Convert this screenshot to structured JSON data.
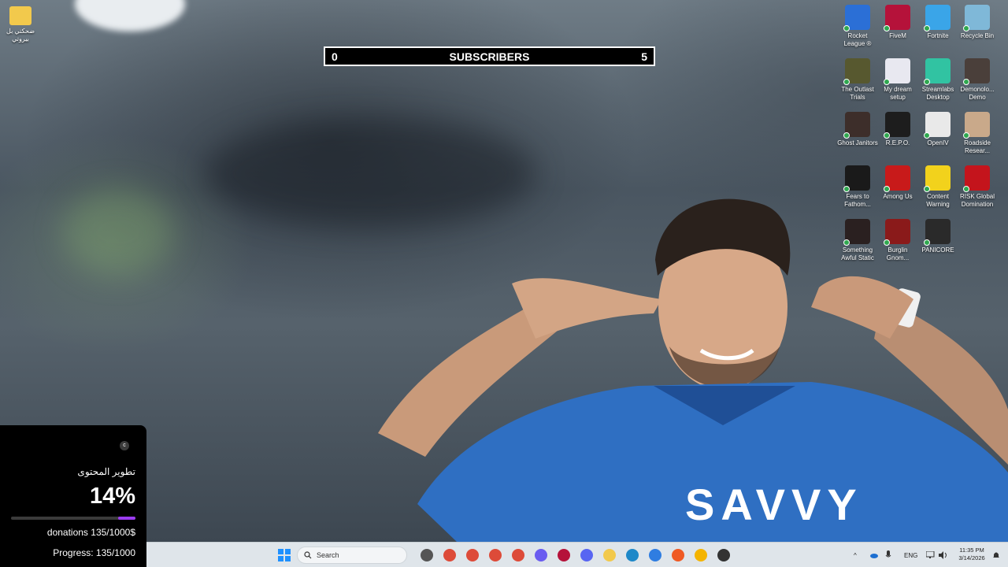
{
  "desktop": {
    "left_icons": [
      {
        "label": "ضحكتي بل بيروتي",
        "icon": "folder-icon",
        "color": "#f2c94c"
      }
    ],
    "icons": [
      {
        "label": "Rocket League ®",
        "icon": "rocket-league-icon",
        "color": "#2b6fd6"
      },
      {
        "label": "FiveM",
        "icon": "fivem-icon",
        "color": "#b5123a"
      },
      {
        "label": "Fortnite",
        "icon": "fortnite-icon",
        "color": "#3aa5e8"
      },
      {
        "label": "Recycle Bin",
        "icon": "recycle-bin-icon",
        "color": "#7fb8d8"
      },
      {
        "label": "The Outlast Trials",
        "icon": "outlast-icon",
        "color": "#57582f"
      },
      {
        "label": "My dream setup",
        "icon": "dream-setup-icon",
        "color": "#e8e8f0"
      },
      {
        "label": "Streamlabs Desktop",
        "icon": "streamlabs-icon",
        "color": "#31c3a2"
      },
      {
        "label": "Demonolo... Demo",
        "icon": "demonologist-icon",
        "color": "#4a3f3a"
      },
      {
        "label": "Ghost Janitors",
        "icon": "ghost-janitors-icon",
        "color": "#3d2e2a"
      },
      {
        "label": "R.E.P.O.",
        "icon": "repo-icon",
        "color": "#1d1d1d"
      },
      {
        "label": "OpenIV",
        "icon": "openiv-icon",
        "color": "#e9e9e9"
      },
      {
        "label": "Roadside Resear...",
        "icon": "roadside-research-icon",
        "color": "#c9a98a"
      },
      {
        "label": "Fears to Fathom...",
        "icon": "fears-to-fathom-icon",
        "color": "#1a1a1a"
      },
      {
        "label": "Among Us",
        "icon": "among-us-icon",
        "color": "#c81a1a"
      },
      {
        "label": "Content Warning",
        "icon": "content-warning-icon",
        "color": "#f2d21c"
      },
      {
        "label": "RISK Global Domination",
        "icon": "risk-icon",
        "color": "#c4141c"
      },
      {
        "label": "Something Awful Static",
        "icon": "something-awful-static-icon",
        "color": "#2a2020"
      },
      {
        "label": "Burglin Gnom...",
        "icon": "burglin-gnomes-icon",
        "color": "#8a1a1a"
      },
      {
        "label": "PANICORE",
        "icon": "panicore-icon",
        "color": "#2a2a2a"
      }
    ]
  },
  "subscriber_bar": {
    "start": "0",
    "title": "SUBSCRIBERS",
    "goal": "5"
  },
  "donation_widget": {
    "logo": "c",
    "title": "تطوير المحتوى",
    "percent_text": "14%",
    "percent": 14,
    "amount": "donations 135/1000$",
    "progress": "Progress: 135/1000",
    "bar_color": "#9b3cf0"
  },
  "taskbar": {
    "search_placeholder": "Search",
    "apps": [
      {
        "name": "start-button",
        "icon": "windows-icon",
        "color": "#1e90ff"
      },
      {
        "name": "file-explorer-small",
        "icon": "task-view-icon",
        "color": "#555"
      },
      {
        "name": "chrome-1",
        "icon": "chrome-icon",
        "color": "#dd4b39"
      },
      {
        "name": "chrome-2",
        "icon": "chrome-icon",
        "color": "#dd4b39"
      },
      {
        "name": "chrome-3",
        "icon": "chrome-icon",
        "color": "#dd4b39"
      },
      {
        "name": "chrome-4",
        "icon": "chrome-icon",
        "color": "#dd4b39"
      },
      {
        "name": "copilot",
        "icon": "copilot-icon",
        "color": "#6a5cf0"
      },
      {
        "name": "fivem",
        "icon": "fivem-icon",
        "color": "#b5123a"
      },
      {
        "name": "discord",
        "icon": "discord-icon",
        "color": "#5865f2"
      },
      {
        "name": "file-explorer",
        "icon": "folder-icon",
        "color": "#f2c94c"
      },
      {
        "name": "edge",
        "icon": "edge-icon",
        "color": "#1e88c8"
      },
      {
        "name": "store",
        "icon": "store-icon",
        "color": "#2f7de1"
      },
      {
        "name": "brave",
        "icon": "brave-icon",
        "color": "#ef5a24"
      },
      {
        "name": "yellow-app",
        "icon": "emoji-app-icon",
        "color": "#f4b400"
      },
      {
        "name": "steam-like",
        "icon": "network-app-icon",
        "color": "#333"
      }
    ],
    "tray": {
      "chevron": "^",
      "language": "ENG",
      "time": "11:35 PM",
      "date": "3/14/2026"
    }
  }
}
